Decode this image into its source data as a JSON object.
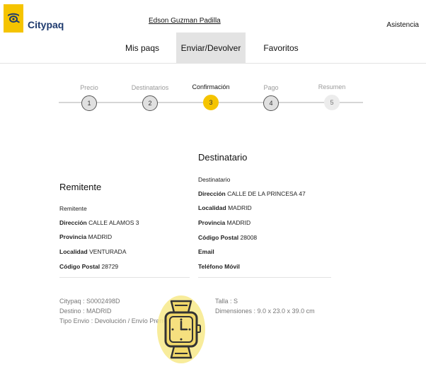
{
  "header": {
    "brand": "Citypaq",
    "user_name": "Edson Guzman Padilla",
    "help": "Asistencia"
  },
  "nav": {
    "tabs": [
      {
        "label": "Mis paqs"
      },
      {
        "label": "Enviar/Devolver"
      },
      {
        "label": "Favoritos"
      }
    ],
    "active_tab": "Enviar/Devolver"
  },
  "steps": [
    {
      "label": "Precio",
      "number": "1"
    },
    {
      "label": "Destinatarios",
      "number": "2"
    },
    {
      "label": "Confirmación",
      "number": "3"
    },
    {
      "label": "Pago",
      "number": "4"
    },
    {
      "label": "Resumen",
      "number": "5"
    }
  ],
  "remitente": {
    "title": "Remitente",
    "name_label": "Remitente",
    "direccion_label": "Dirección",
    "direccion": "CALLE ALAMOS 3",
    "provincia_label": "Provincia",
    "provincia": "MADRID",
    "localidad_label": "Localidad",
    "localidad": "VENTURADA",
    "cp_label": "Código Postal",
    "cp": "28729"
  },
  "destinatario": {
    "title": "Destinatario",
    "name_label": "Destinatario",
    "direccion_label": "Dirección",
    "direccion": "CALLE DE LA PRINCESA 47",
    "localidad_label": "Localidad",
    "localidad": "MADRID",
    "provincia_label": "Provincia",
    "provincia": "MADRID",
    "cp_label": "Código Postal",
    "cp": "28008",
    "email_label": "Email",
    "telefono_label": "Teléfono Móvil"
  },
  "summary": {
    "citypaq": "Citypaq : S0002498D",
    "destino": "Destino : MADRID",
    "tipo": "Tipo Envio : Devolución / Envío Prerregistrado",
    "talla": "Talla : S",
    "dimensiones": "Dimensiones : 9.0 x 23.0 x 39.0 cm"
  },
  "colors": {
    "accent_yellow": "#f5c400",
    "brand_blue": "#1e3a6e",
    "active_tab_bg": "#e3e3e3"
  },
  "icons": {
    "logo": "post-horn-icon",
    "package": "watch-icon"
  }
}
